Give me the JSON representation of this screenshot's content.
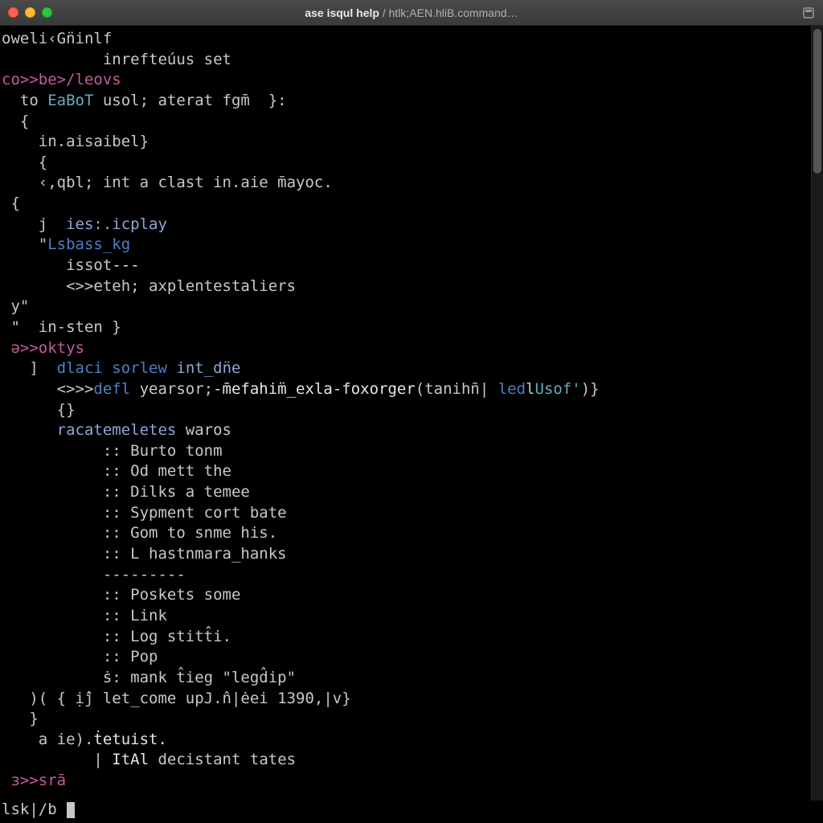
{
  "window": {
    "title_bold": "ase isqul help",
    "title_sep": " / ",
    "title_dim": "htlk;AEN.hliB.command…"
  },
  "terminal": {
    "lines": [
      [
        [
          "g",
          "oweli‹Gn̈inlf"
        ]
      ],
      [
        [
          "g",
          "           inrefteúus set"
        ]
      ],
      [
        [
          "m",
          "co>>be>/leovs"
        ]
      ],
      [
        [
          "g",
          "  to "
        ],
        [
          "c",
          "EaBoT"
        ],
        [
          "g",
          " usol; aterat fgm̄  }:"
        ]
      ],
      [
        [
          "g",
          "  {"
        ]
      ],
      [
        [
          "g",
          "    in.aisaibel}"
        ]
      ],
      [
        [
          "g",
          "    {"
        ]
      ],
      [
        [
          "g",
          "    ‹,qbl; int a clast in.aie m̄ayoc."
        ]
      ],
      [
        [
          "g",
          " {"
        ]
      ],
      [
        [
          "g",
          "    j  "
        ],
        [
          "lb",
          "ies:.icplay"
        ]
      ],
      [
        [
          "g",
          "    \""
        ],
        [
          "b",
          "Lsbass_kg"
        ]
      ],
      [
        [
          "g",
          "       issot"
        ],
        [
          "w",
          "---"
        ]
      ],
      [
        [
          "g",
          "       <>>eteh; axplentestaliers"
        ]
      ],
      [
        [
          "g",
          " y\""
        ]
      ],
      [
        [
          "g",
          " \"  in-sten }"
        ]
      ],
      [
        [
          "m",
          " ə>>oktys"
        ]
      ],
      [
        [
          "g",
          "   ]  "
        ],
        [
          "b",
          "dlaci sorlew"
        ],
        [
          "g",
          " "
        ],
        [
          "lb",
          "int_dn̈e"
        ]
      ],
      [
        [
          "g",
          "      <>>>"
        ],
        [
          "b",
          "defl"
        ],
        [
          "g",
          " yearsor;"
        ],
        [
          "w",
          "-m̄efahim̈_exla-foxorger"
        ],
        [
          "g",
          "(tanihn̄| "
        ],
        [
          "b",
          "led"
        ],
        [
          "g",
          "l"
        ],
        [
          "c",
          "Usof'"
        ],
        [
          "g",
          ")}"
        ]
      ],
      [
        [
          "g",
          "      {}"
        ]
      ],
      [
        [
          "g",
          "      "
        ],
        [
          "lb",
          "racatemeletes"
        ],
        [
          "g",
          " waros"
        ]
      ],
      [
        [
          "g",
          "           :: Burto tonm"
        ]
      ],
      [
        [
          "g",
          "           :: Od mett the"
        ]
      ],
      [
        [
          "g",
          "           :: Dilks a temee"
        ]
      ],
      [
        [
          "g",
          "           :: Sypment cort bate"
        ]
      ],
      [
        [
          "g",
          "           :: Gom to snme his."
        ]
      ],
      [
        [
          "g",
          "           :: L hastnmara_hanks"
        ]
      ],
      [
        [
          "g",
          "           ---------"
        ]
      ],
      [
        [
          "g",
          "           :: Poskets some"
        ]
      ],
      [
        [
          "g",
          "           :: Link"
        ]
      ],
      [
        [
          "g",
          "           :: Log stitt̂i."
        ]
      ],
      [
        [
          "g",
          "           :: Pop"
        ]
      ],
      [
        [
          "g",
          "           ṡ: mank t̂ieg \"legd̂ip\""
        ]
      ],
      [
        [
          "g",
          ""
        ]
      ],
      [
        [
          "g",
          "   )( { ị̂j let_come upJ.n̂|ėei 1390,|v}"
        ]
      ],
      [
        [
          "g",
          "   }"
        ]
      ],
      [
        [
          "g",
          "    a ie)."
        ],
        [
          "w",
          "ṫetuist."
        ]
      ],
      [
        [
          "g",
          "          | "
        ],
        [
          "w",
          "ItAl"
        ],
        [
          "g",
          " decistant tates"
        ]
      ],
      [
        [
          "m",
          " ɜ>>srā"
        ]
      ]
    ],
    "prompt": "lsk|/b "
  }
}
